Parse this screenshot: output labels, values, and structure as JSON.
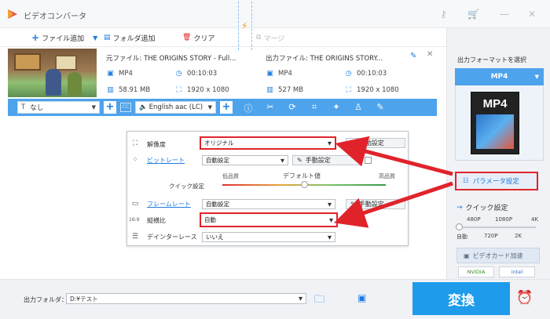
{
  "window": {
    "title": "ビデオコンバータ",
    "icons": [
      "key-icon",
      "cart-icon",
      "minimize-icon",
      "close-icon"
    ]
  },
  "toolbar": {
    "add_file": "ファイル追加",
    "add_folder": "フォルダ追加",
    "clear": "クリア",
    "merge": "マージ"
  },
  "file": {
    "source_name": "元ファイル: THE ORIGINS STORY - Full...",
    "source_format": "MP4",
    "source_duration": "00:10:03",
    "source_size": "58.91 MB",
    "source_resolution": "1920 x 1080",
    "output_name": "出力ファイル: THE ORIGINS STORY...",
    "output_format": "MP4",
    "output_duration": "00:10:03",
    "output_size": "527 MB",
    "output_resolution": "1920 x 1080"
  },
  "edit_strip": {
    "subtitle_value": "なし",
    "audio_value": "English aac (LC)"
  },
  "settings": {
    "resolution_label": "解像度",
    "resolution_value": "オリジナル",
    "bitrate_label": "ビットレート",
    "bitrate_value": "自動設定",
    "manual_label": "手動設定",
    "quick_label": "クイック設定",
    "low_quality": "低品質",
    "default_value": "デフォルト値",
    "high_quality": "高品質",
    "framerate_label": "フレームレート",
    "framerate_value": "自動設定",
    "aspect_label": "縦横比",
    "aspect_value": "自動",
    "deinterlace_label": "デインターレース",
    "deinterlace_value": "いいえ"
  },
  "right_panel": {
    "select_format": "出力フォーマットを選択",
    "format": "MP4",
    "format_icon_label": "MP4",
    "param_button": "パラメータ設定",
    "quick_settings": "クイック設定",
    "quick_top_labels": [
      "480P",
      "1080P",
      "4K"
    ],
    "quick_bottom_labels": [
      "自動",
      "720P",
      "2K"
    ],
    "gpu_button": "ビデオカード加速",
    "chips": [
      "NVIDIA",
      "intel"
    ]
  },
  "bottom": {
    "output_folder_label": "出力フォルダ：",
    "output_path": "D:¥テスト",
    "convert": "変換"
  },
  "colors": {
    "accent": "#1e7ae0",
    "strip": "#4da3ec",
    "convert": "#1e9bea",
    "highlight": "#e0232b"
  }
}
